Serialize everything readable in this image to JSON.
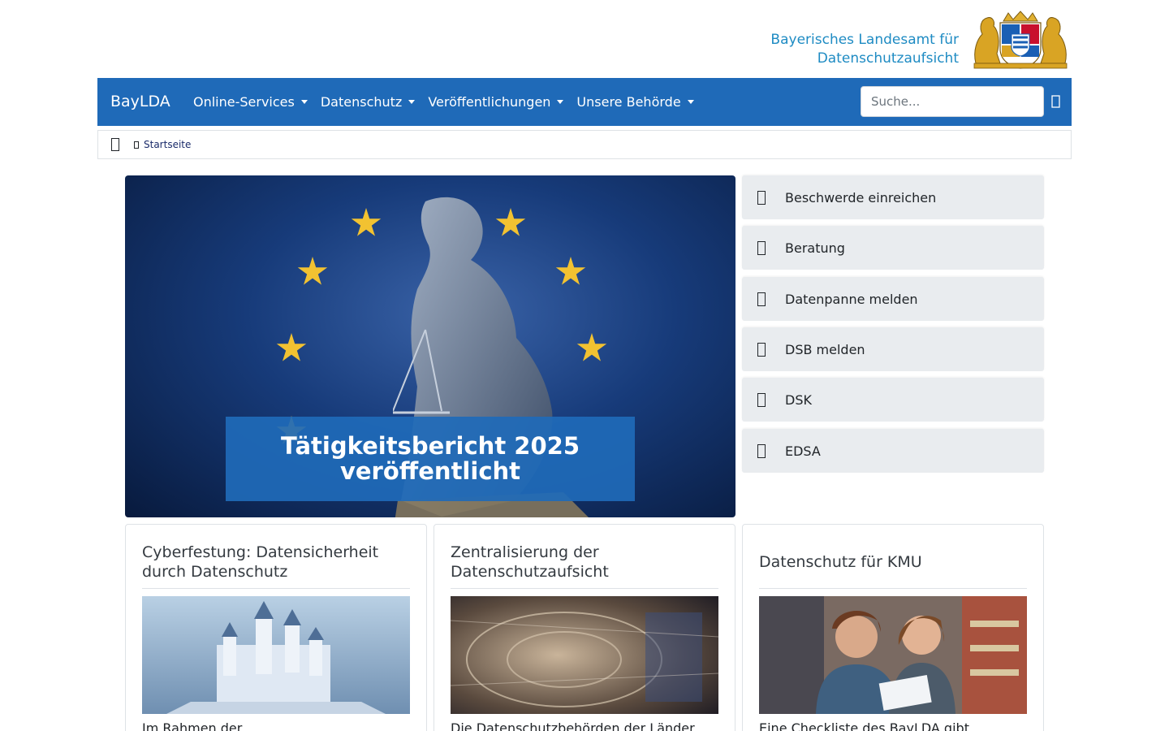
{
  "header": {
    "org_name_line1": "Bayerisches Landesamt für",
    "org_name_line2": "Datenschutzaufsicht",
    "logo_icon": "bavarian-coat-of-arms-icon"
  },
  "navbar": {
    "brand": "BayLDA",
    "items": [
      {
        "label": "Online-Services"
      },
      {
        "label": "Datenschutz"
      },
      {
        "label": "Veröffentlichungen"
      },
      {
        "label": "Unsere Behörde"
      }
    ],
    "search_placeholder": "Suche...",
    "search_icon": "search-icon",
    "bg_color": "#1f6ab8"
  },
  "breadcrumb": {
    "home_icon": "home-icon",
    "items": [
      {
        "label": "Startseite"
      }
    ]
  },
  "hero": {
    "caption": "Tätigkeitsbericht 2025 veröffentlicht"
  },
  "quick_links": [
    {
      "label": "Beschwerde einreichen"
    },
    {
      "label": "Beratung"
    },
    {
      "label": "Datenpanne melden"
    },
    {
      "label": "DSB melden"
    },
    {
      "label": "DSK"
    },
    {
      "label": "EDSA"
    }
  ],
  "cards": [
    {
      "title": "Cyberfestung: Datensicherheit durch Datenschutz",
      "text": "Im Rahmen der"
    },
    {
      "title": "Zentralisierung der Datenschutzaufsicht",
      "text": "Die Datenschutzbehörden der Länder"
    },
    {
      "title": "Datenschutz für KMU",
      "text": "Eine Checkliste des BayLDA gibt"
    }
  ]
}
